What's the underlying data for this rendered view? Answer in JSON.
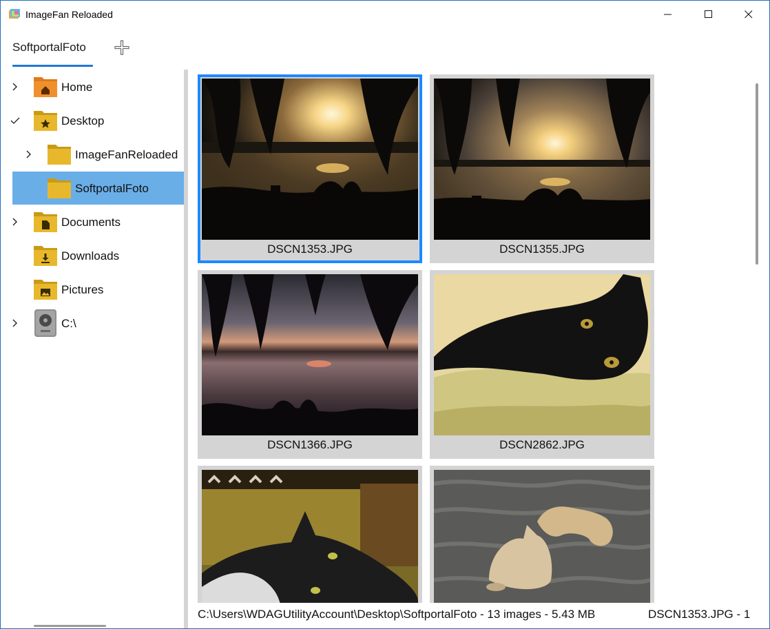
{
  "window": {
    "title": "ImageFan Reloaded",
    "accent": "#1e78d2",
    "buttons": {
      "minimize": "minimize-icon",
      "maximize": "maximize-icon",
      "close": "close-icon"
    }
  },
  "tabs": [
    {
      "label": "SoftportalFoto",
      "active": true
    }
  ],
  "add_tab_icon": "plus-icon",
  "tree": [
    {
      "label": "Home",
      "icon": "home-folder-icon",
      "level": 0,
      "expander": "chevron-right"
    },
    {
      "label": "Desktop",
      "icon": "desktop-folder-icon",
      "level": 0,
      "expander": "checkmark"
    },
    {
      "label": "ImageFanReloaded",
      "icon": "folder-icon",
      "level": 1,
      "expander": "chevron-right"
    },
    {
      "label": "SoftportalFoto",
      "icon": "folder-icon",
      "level": 1,
      "expander": "",
      "selected": true
    },
    {
      "label": "Documents",
      "icon": "documents-folder-icon",
      "level": 0,
      "expander": "chevron-right"
    },
    {
      "label": "Downloads",
      "icon": "downloads-folder-icon",
      "level": 0,
      "expander": ""
    },
    {
      "label": "Pictures",
      "icon": "pictures-folder-icon",
      "level": 0,
      "expander": ""
    },
    {
      "label": "C:\\",
      "icon": "drive-icon",
      "level": 0,
      "expander": "chevron-right"
    }
  ],
  "thumbnails": [
    {
      "name": "DSCN1353.JPG",
      "selected": true,
      "scene": "sunset-willows"
    },
    {
      "name": "DSCN1355.JPG",
      "selected": false,
      "scene": "sunset-willows"
    },
    {
      "name": "DSCN1366.JPG",
      "selected": false,
      "scene": "dusk-lake"
    },
    {
      "name": "DSCN2862.JPG",
      "selected": false,
      "scene": "black-cat"
    },
    {
      "name": "",
      "selected": false,
      "scene": "cat-on-couch"
    },
    {
      "name": "",
      "selected": false,
      "scene": "two-cats"
    }
  ],
  "status": {
    "path_info": "C:\\Users\\WDAGUtilityAccount\\Desktop\\SoftportalFoto - 13 images - 5.43 MB",
    "selection_info": "DSCN1353.JPG - 1"
  },
  "colors": {
    "selection_border": "#1e88ff",
    "tree_selected": "#6aaee8",
    "folder": "#e8b82c",
    "home_folder": "#f0902c"
  }
}
